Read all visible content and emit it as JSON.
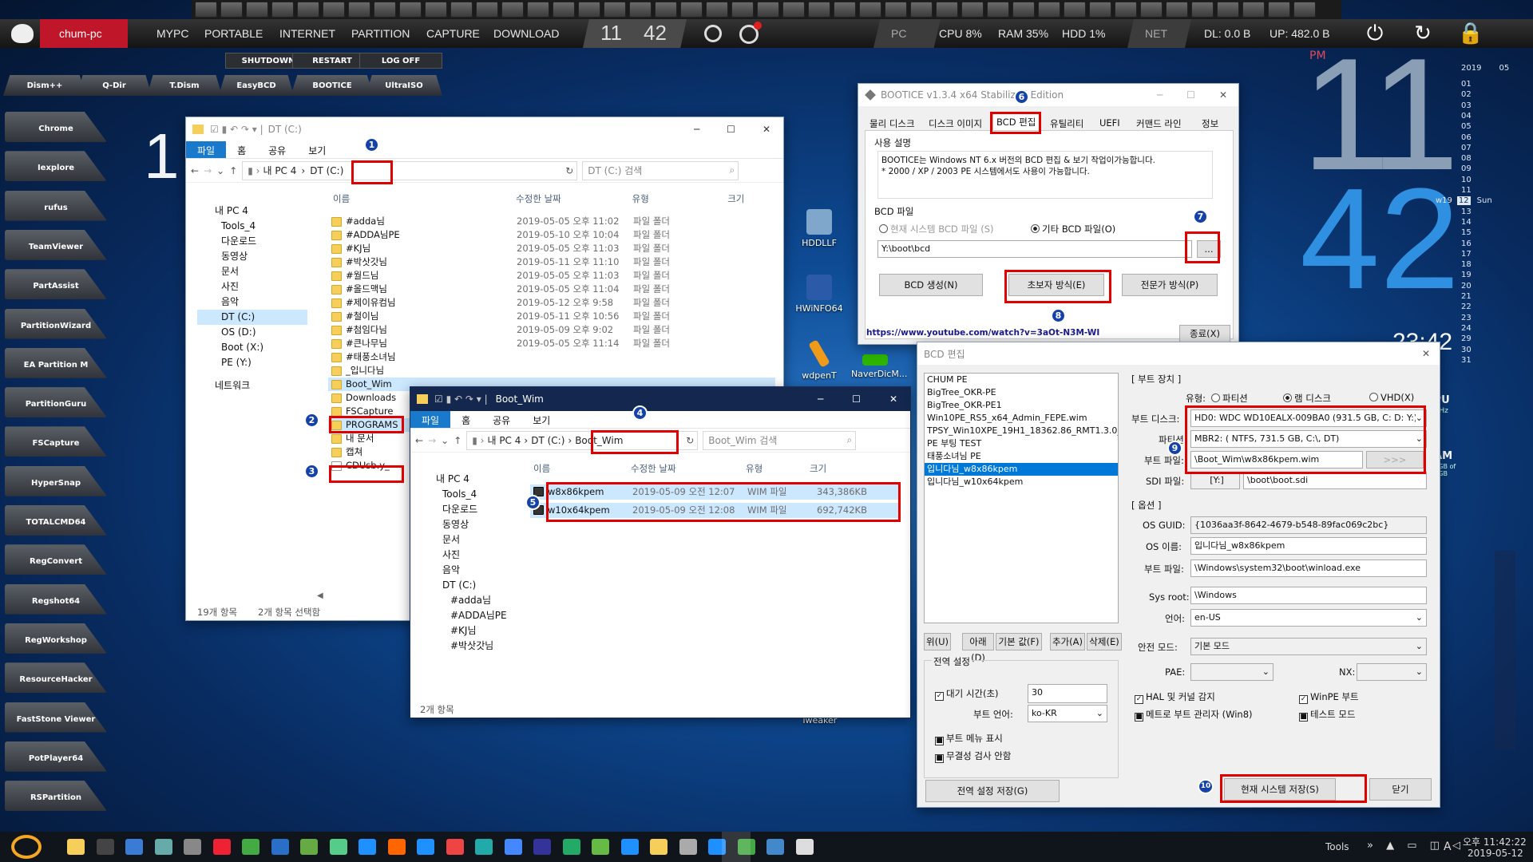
{
  "topbar": {
    "user": "chum-pc",
    "menus": [
      "MYPC",
      "PORTABLE",
      "INTERNET",
      "PARTITION",
      "CAPTURE",
      "DOWNLOAD"
    ],
    "hour": "11",
    "minute": "42",
    "pc": "PC",
    "cpu": "CPU 8%",
    "ram": "RAM 35%",
    "hdd": "HDD 1%",
    "net": "NET",
    "dl": "DL: 0.0 B",
    "up": "UP: 482.0 B"
  },
  "sysbuttons": [
    "SHUTDOWN",
    "RESTART",
    "LOG OFF"
  ],
  "launchers_top": [
    "Dism++",
    "Q-Dir",
    "T.Dism",
    "EasyBCD",
    "BOOTICE",
    "UltraISO"
  ],
  "launchers_left": [
    "Chrome",
    "Iexplore",
    "rufus",
    "TeamViewer",
    "PartAssist",
    "PartitionWizard",
    "EA Partition M",
    "PartitionGuru",
    "FSCapture",
    "HyperSnap",
    "TOTALCMD64",
    "RegConvert",
    "Regshot64",
    "RegWorkshop",
    "ResourceHacker",
    "FastStone Viewer",
    "PotPlayer64",
    "RSPartition"
  ],
  "desktop_icons": [
    "HDDLLF",
    "HWiNFO64",
    "wdpenT",
    "NaverDicM...",
    "Tweaker"
  ],
  "clock": {
    "pm": "PM",
    "big_hour": "11",
    "big_minute": "42",
    "small": "23:42"
  },
  "side_meters": {
    "cpu": "CPU",
    "cpu_mhz": "0 MHz",
    "ram": "RAM",
    "ram_detail": "2.8 GB of 8.0 GB"
  },
  "calendar": {
    "year": "2019",
    "month": "05",
    "week": "w19",
    "today": "12",
    "dow": "Sun",
    "days": [
      "01",
      "02",
      "03",
      "04",
      "05",
      "06",
      "07",
      "08",
      "09",
      "10",
      "11",
      "12",
      "13",
      "14",
      "15",
      "16",
      "17",
      "18",
      "19",
      "20",
      "21",
      "22",
      "23",
      "24",
      "29",
      "30",
      "31"
    ]
  },
  "explorer1": {
    "path": "DT (C:)",
    "ribbon": [
      "파일",
      "홈",
      "공유",
      "보기"
    ],
    "crumbs": [
      "내 PC 4",
      "DT (C:)"
    ],
    "search": "DT (C:) 검색",
    "nav": [
      "내 PC 4",
      "Tools_4",
      "다운로드",
      "동영상",
      "문서",
      "사진",
      "음악",
      "DT (C:)",
      "OS (D:)",
      "Boot (X:)",
      "PE (Y:)",
      "네트워크"
    ],
    "cols": [
      "이름",
      "수정한 날짜",
      "유형",
      "크기"
    ],
    "rows": [
      [
        "#adda님",
        "2019-05-05 오후 11:02",
        "파일 폴더"
      ],
      [
        "#ADDA님PE",
        "2019-05-10 오후 10:04",
        "파일 폴더"
      ],
      [
        "#KJ님",
        "2019-05-05 오후 11:03",
        "파일 폴더"
      ],
      [
        "#박삿갓님",
        "2019-05-11 오후 11:10",
        "파일 폴더"
      ],
      [
        "#월드님",
        "2019-05-05 오후 11:03",
        "파일 폴더"
      ],
      [
        "#올드맥님",
        "2019-05-05 오후 11:04",
        "파일 폴더"
      ],
      [
        "#제이유컴님",
        "2019-05-12 오후 9:58",
        "파일 폴더"
      ],
      [
        "#철이님",
        "2019-05-11 오후 10:56",
        "파일 폴더"
      ],
      [
        "#첨임다님",
        "2019-05-09 오후 9:02",
        "파일 폴더"
      ],
      [
        "#큰나무님",
        "2019-05-05 오후 11:14",
        "파일 폴더"
      ],
      [
        "#태풍소녀님",
        "",
        ""
      ],
      [
        "_입니다님",
        "",
        ""
      ],
      [
        "Boot_Wim",
        "",
        ""
      ],
      [
        "Downloads",
        "",
        ""
      ],
      [
        "FSCapture",
        "",
        ""
      ],
      [
        "PROGRAMS",
        "",
        ""
      ],
      [
        "내 문서",
        "",
        ""
      ],
      [
        "캡쳐",
        "",
        ""
      ],
      [
        "CDUsb.y_",
        "",
        ""
      ]
    ],
    "status_items": "19개 항목",
    "status_sel": "2개 항목 선택함"
  },
  "explorer2": {
    "title": "Boot_Wim",
    "ribbon": [
      "파일",
      "홈",
      "공유",
      "보기"
    ],
    "crumbs": [
      "내 PC 4",
      "DT (C:)",
      "Boot_Wim"
    ],
    "search": "Boot_Wim 검색",
    "nav": [
      "내 PC 4",
      "Tools_4",
      "다운로드",
      "동영상",
      "문서",
      "사진",
      "음악",
      "DT (C:)",
      "#adda님",
      "#ADDA님PE",
      "#KJ님",
      "#박삿갓님"
    ],
    "cols": [
      "이름",
      "수정한 날짜",
      "유형",
      "크기"
    ],
    "rows": [
      [
        "w8x86kpem",
        "2019-05-09 오전 12:07",
        "WIM 파일",
        "343,386KB"
      ],
      [
        "w10x64kpem",
        "2019-05-09 오전 12:08",
        "WIM 파일",
        "692,742KB"
      ]
    ],
    "status": "2개 항목"
  },
  "bootice": {
    "title": "BOOTICE v1.3.4 x64 Stabilized Edition",
    "tabs": [
      "물리 디스크",
      "디스크 이미지",
      "BCD 편집",
      "유틸리티",
      "UEFI",
      "커맨드 라인",
      "정보"
    ],
    "usage_title": "사용 설명",
    "usage_text": "BOOTICE는 Windows NT 6.x 버전의 BCD 편집 & 보기 작업이가능합니다.\n* 2000 / XP / 2003 PE 시스템에서도 사용이 가능합니다.",
    "bcd_file_title": "BCD 파일",
    "radio_current": "현재 시스템 BCD 파일 (S)",
    "radio_other": "기타 BCD 파일(O)",
    "bcd_path": "Y:\\boot\\bcd",
    "browse": "...",
    "btn_create": "BCD 생성(N)",
    "btn_easy": "초보자 방식(E)",
    "btn_expert": "전문가 방식(P)",
    "link": "https://www.youtube.com/watch?v=3aOt-N3M-WI",
    "btn_close": "종료(X)"
  },
  "bcdedit": {
    "title": "BCD 편집",
    "entries": [
      "CHUM PE",
      "BigTree_OKR-PE",
      "BigTree_OKR-PE1",
      "Win10PE_RS5_x64_Admin_FEPE.wim",
      "TPSY_Win10XPE_19H1_18362.86_RMT1.3.0_pE",
      "PE 부팅 TEST",
      "태풍소녀님 PE",
      "입니다님_w8x86kpem",
      "입니다님_w10x64kpem"
    ],
    "list_buttons": [
      "위(U)",
      "아래(D)",
      "기본 값(F)",
      "추가(A)",
      "삭제(E)"
    ],
    "global_title": "전역 설정",
    "timeout_label": "대기 시간(초)",
    "timeout": "30",
    "bootlang_label": "부트 언어:",
    "bootlang": "ko-KR",
    "chk_menu": "부트 메뉴 표시",
    "chk_integrity": "무결성 검사 안함",
    "btn_save_global": "전역 설정 저장(G)",
    "device_title": "[ 부트 장치 ]",
    "type_label": "유형:",
    "type_part": "파티션",
    "type_ram": "램 디스크",
    "type_vhd": "VHD(X)",
    "disk_label": "부트 디스크:",
    "disk": "HD0: WDC WD10EALX-009BA0 (931.5 GB, C: D: Y:)",
    "part_label": "파티션:",
    "part": "MBR2: ( NTFS, 731.5 GB, C:\\, DT)",
    "file_label": "부트 파일:",
    "file": "\\Boot_Wim\\w8x86kpem.wim",
    "file_btn": ">>>",
    "sdi_label": "SDI 파일:",
    "sdi_drive": "[Y:]",
    "sdi": "\\boot\\boot.sdi",
    "opt_title": "[ 옵션 ]",
    "guid_label": "OS GUID:",
    "guid": "{1036aa3f-8642-4679-b548-89fac069c2bc}",
    "osname_label": "OS 이름:",
    "osname": "입니다님_w8x86kpem",
    "bootfile_label": "부트 파일:",
    "bootfile": "\\Windows\\system32\\boot\\winload.exe",
    "sysroot_label": "Sys root:",
    "sysroot": "\\Windows",
    "lang_label": "언어:",
    "lang": "en-US",
    "safe_label": "안전 모드:",
    "safe": "기본 모드",
    "pae_label": "PAE:",
    "nx_label": "NX:",
    "chk_hal": "HAL 및 커널 감지",
    "chk_winpe": "WinPE 부트",
    "chk_metro": "메트로 부트 관리자 (Win8)",
    "chk_test": "테스트 모드",
    "btn_save": "현재 시스템 저장(S)",
    "btn_close": "닫기"
  },
  "badges": [
    "1",
    "2",
    "3",
    "4",
    "5",
    "6",
    "7",
    "8",
    "9",
    "10"
  ],
  "taskbar": {
    "tools": "Tools",
    "time": "오후 11:42:22",
    "date": "2019-05-12",
    "lang": "A"
  }
}
